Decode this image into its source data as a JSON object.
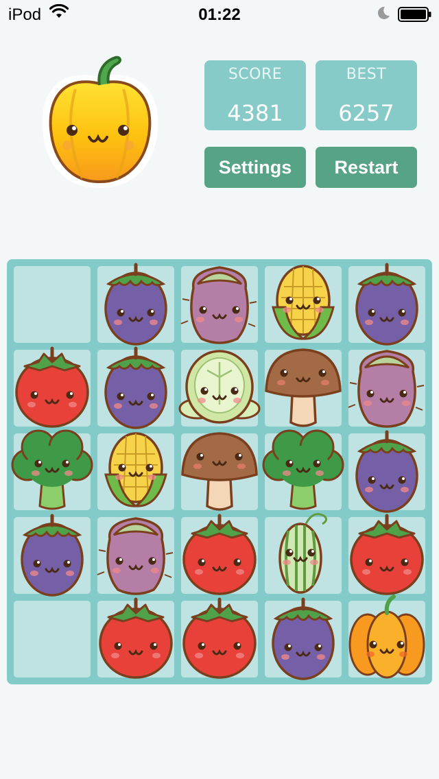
{
  "status_bar": {
    "carrier": "iPod",
    "time": "01:22"
  },
  "header": {
    "score_label": "SCORE",
    "score_value": "4381",
    "best_label": "BEST",
    "best_value": "6257",
    "settings_label": "Settings",
    "restart_label": "Restart",
    "logo_icon": "yellow-pepper-icon"
  },
  "colors": {
    "background": "#f3f7f7",
    "score_box": "#87cbc8",
    "button": "#56a386",
    "board": "#83cbc9",
    "cell": "#bfe3e2"
  },
  "board": {
    "columns": 5,
    "rows": 5,
    "cells": [
      [
        "empty",
        "eggplant",
        "sweet-potato",
        "corn",
        "eggplant"
      ],
      [
        "tomato",
        "eggplant",
        "cabbage",
        "mushroom",
        "sweet-potato"
      ],
      [
        "broccoli",
        "corn",
        "mushroom",
        "broccoli",
        "eggplant"
      ],
      [
        "eggplant",
        "sweet-potato",
        "tomato",
        "cucumber",
        "tomato"
      ],
      [
        "empty",
        "tomato",
        "tomato",
        "eggplant",
        "pumpkin"
      ]
    ]
  }
}
